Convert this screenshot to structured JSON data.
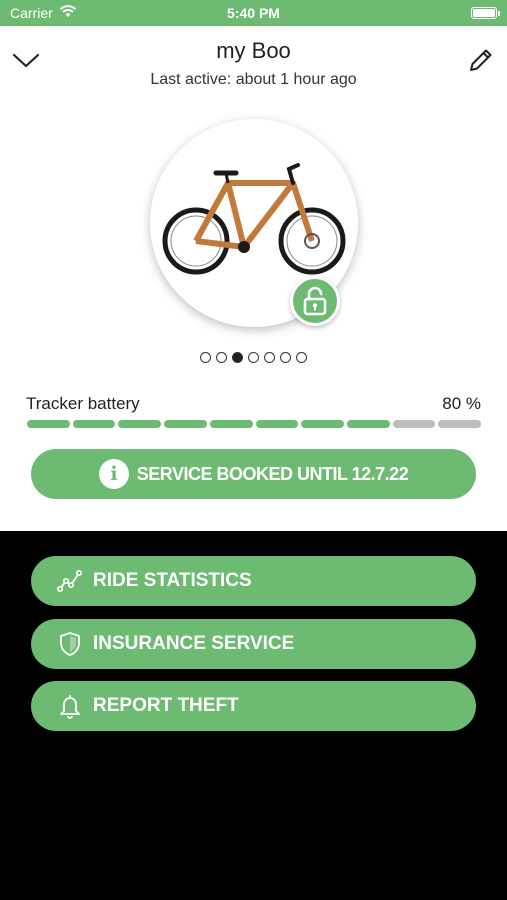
{
  "status_bar": {
    "carrier": "Carrier",
    "time": "5:40 PM"
  },
  "header": {
    "title": "my Boo",
    "subtitle": "Last active: about 1 hour ago"
  },
  "carousel": {
    "dot_count": 7,
    "active_index": 2
  },
  "tracker_battery": {
    "label": "Tracker battery",
    "value": "80 %",
    "fraction": 0.8,
    "segments": 10
  },
  "service_button": {
    "label": "SERVICE BOOKED UNTIL 12.7.22",
    "icon": "info-icon"
  },
  "actions": [
    {
      "label": "RIDE STATISTICS",
      "icon": "statistics-icon"
    },
    {
      "label": "INSURANCE SERVICE",
      "icon": "shield-icon"
    },
    {
      "label": "REPORT THEFT",
      "icon": "bell-icon"
    }
  ],
  "colors": {
    "accent": "#6dba72",
    "background_dark": "#000000",
    "panel": "#ffffff",
    "inactive_segment": "#bdbdbd"
  }
}
